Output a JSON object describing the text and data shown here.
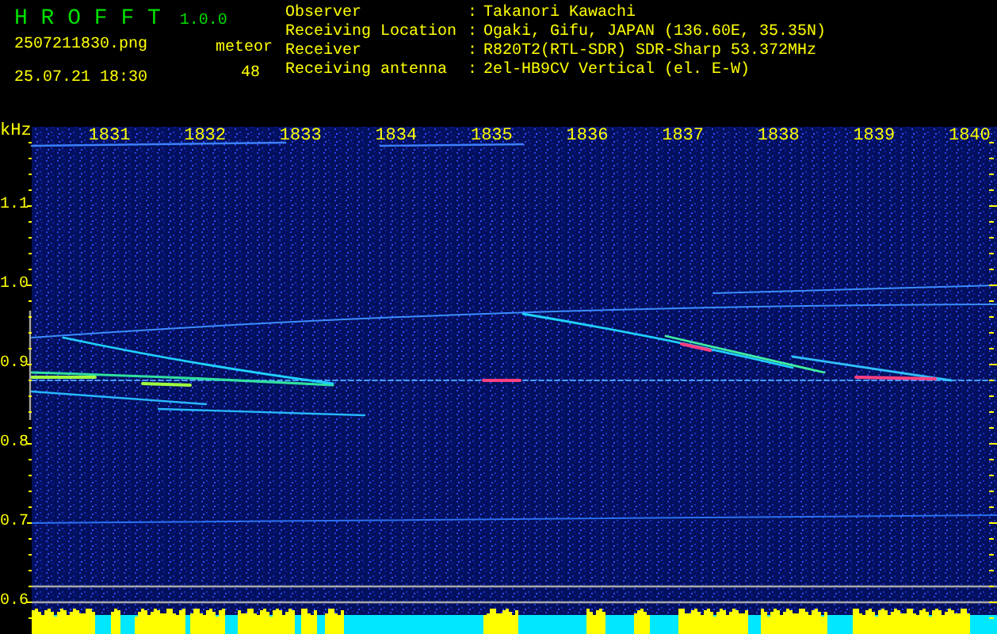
{
  "app": {
    "title": "H R O F F T",
    "version": "1.0.0"
  },
  "file": {
    "name": "2507211830.png",
    "datetime": "25.07.21 18:30"
  },
  "count": {
    "label": "meteor",
    "value": "48"
  },
  "info": [
    {
      "label": "Observer",
      "separator": ":",
      "value": "Takanori Kawachi"
    },
    {
      "label": "Receiving Location",
      "separator": ":",
      "value": "Ogaki, Gifu, JAPAN (136.60E, 35.35N)"
    },
    {
      "label": "Receiver",
      "separator": ":",
      "value": "R820T2(RTL-SDR) SDR-Sharp 53.372MHz"
    },
    {
      "label": "Receiving antenna",
      "separator": ":",
      "value": "2el-HB9CV Vertical (el. E-W)"
    }
  ],
  "plot": {
    "unit": "kHz",
    "x_labels": [
      "1831",
      "1832",
      "1833",
      "1834",
      "1835",
      "1836",
      "1837",
      "1838",
      "1839",
      "1840"
    ],
    "y_labels": [
      "1.1",
      "1.0",
      "0.9",
      "0.8",
      "0.7",
      "0.6"
    ]
  }
}
